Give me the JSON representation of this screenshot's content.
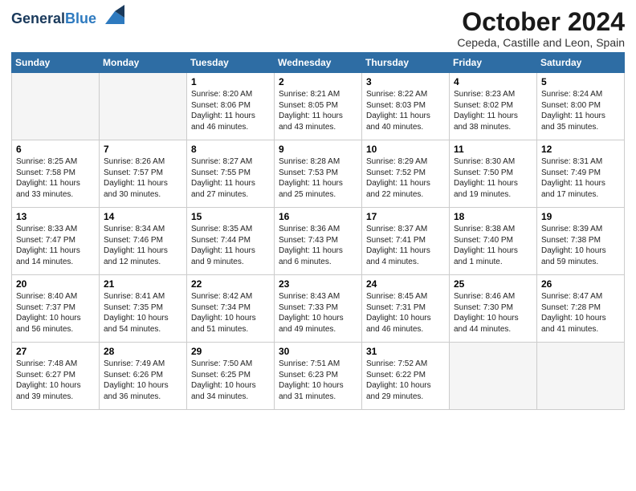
{
  "header": {
    "logo_line1": "General",
    "logo_line2": "Blue",
    "month_title": "October 2024",
    "subtitle": "Cepeda, Castille and Leon, Spain"
  },
  "weekdays": [
    "Sunday",
    "Monday",
    "Tuesday",
    "Wednesday",
    "Thursday",
    "Friday",
    "Saturday"
  ],
  "weeks": [
    [
      {
        "day": "",
        "empty": true
      },
      {
        "day": "",
        "empty": true
      },
      {
        "day": "1",
        "sunrise": "8:20 AM",
        "sunset": "8:06 PM",
        "daylight": "11 hours and 46 minutes."
      },
      {
        "day": "2",
        "sunrise": "8:21 AM",
        "sunset": "8:05 PM",
        "daylight": "11 hours and 43 minutes."
      },
      {
        "day": "3",
        "sunrise": "8:22 AM",
        "sunset": "8:03 PM",
        "daylight": "11 hours and 40 minutes."
      },
      {
        "day": "4",
        "sunrise": "8:23 AM",
        "sunset": "8:02 PM",
        "daylight": "11 hours and 38 minutes."
      },
      {
        "day": "5",
        "sunrise": "8:24 AM",
        "sunset": "8:00 PM",
        "daylight": "11 hours and 35 minutes."
      }
    ],
    [
      {
        "day": "6",
        "sunrise": "8:25 AM",
        "sunset": "7:58 PM",
        "daylight": "11 hours and 33 minutes."
      },
      {
        "day": "7",
        "sunrise": "8:26 AM",
        "sunset": "7:57 PM",
        "daylight": "11 hours and 30 minutes."
      },
      {
        "day": "8",
        "sunrise": "8:27 AM",
        "sunset": "7:55 PM",
        "daylight": "11 hours and 27 minutes."
      },
      {
        "day": "9",
        "sunrise": "8:28 AM",
        "sunset": "7:53 PM",
        "daylight": "11 hours and 25 minutes."
      },
      {
        "day": "10",
        "sunrise": "8:29 AM",
        "sunset": "7:52 PM",
        "daylight": "11 hours and 22 minutes."
      },
      {
        "day": "11",
        "sunrise": "8:30 AM",
        "sunset": "7:50 PM",
        "daylight": "11 hours and 19 minutes."
      },
      {
        "day": "12",
        "sunrise": "8:31 AM",
        "sunset": "7:49 PM",
        "daylight": "11 hours and 17 minutes."
      }
    ],
    [
      {
        "day": "13",
        "sunrise": "8:33 AM",
        "sunset": "7:47 PM",
        "daylight": "11 hours and 14 minutes."
      },
      {
        "day": "14",
        "sunrise": "8:34 AM",
        "sunset": "7:46 PM",
        "daylight": "11 hours and 12 minutes."
      },
      {
        "day": "15",
        "sunrise": "8:35 AM",
        "sunset": "7:44 PM",
        "daylight": "11 hours and 9 minutes."
      },
      {
        "day": "16",
        "sunrise": "8:36 AM",
        "sunset": "7:43 PM",
        "daylight": "11 hours and 6 minutes."
      },
      {
        "day": "17",
        "sunrise": "8:37 AM",
        "sunset": "7:41 PM",
        "daylight": "11 hours and 4 minutes."
      },
      {
        "day": "18",
        "sunrise": "8:38 AM",
        "sunset": "7:40 PM",
        "daylight": "11 hours and 1 minute."
      },
      {
        "day": "19",
        "sunrise": "8:39 AM",
        "sunset": "7:38 PM",
        "daylight": "10 hours and 59 minutes."
      }
    ],
    [
      {
        "day": "20",
        "sunrise": "8:40 AM",
        "sunset": "7:37 PM",
        "daylight": "10 hours and 56 minutes."
      },
      {
        "day": "21",
        "sunrise": "8:41 AM",
        "sunset": "7:35 PM",
        "daylight": "10 hours and 54 minutes."
      },
      {
        "day": "22",
        "sunrise": "8:42 AM",
        "sunset": "7:34 PM",
        "daylight": "10 hours and 51 minutes."
      },
      {
        "day": "23",
        "sunrise": "8:43 AM",
        "sunset": "7:33 PM",
        "daylight": "10 hours and 49 minutes."
      },
      {
        "day": "24",
        "sunrise": "8:45 AM",
        "sunset": "7:31 PM",
        "daylight": "10 hours and 46 minutes."
      },
      {
        "day": "25",
        "sunrise": "8:46 AM",
        "sunset": "7:30 PM",
        "daylight": "10 hours and 44 minutes."
      },
      {
        "day": "26",
        "sunrise": "8:47 AM",
        "sunset": "7:28 PM",
        "daylight": "10 hours and 41 minutes."
      }
    ],
    [
      {
        "day": "27",
        "sunrise": "7:48 AM",
        "sunset": "6:27 PM",
        "daylight": "10 hours and 39 minutes."
      },
      {
        "day": "28",
        "sunrise": "7:49 AM",
        "sunset": "6:26 PM",
        "daylight": "10 hours and 36 minutes."
      },
      {
        "day": "29",
        "sunrise": "7:50 AM",
        "sunset": "6:25 PM",
        "daylight": "10 hours and 34 minutes."
      },
      {
        "day": "30",
        "sunrise": "7:51 AM",
        "sunset": "6:23 PM",
        "daylight": "10 hours and 31 minutes."
      },
      {
        "day": "31",
        "sunrise": "7:52 AM",
        "sunset": "6:22 PM",
        "daylight": "10 hours and 29 minutes."
      },
      {
        "day": "",
        "empty": true
      },
      {
        "day": "",
        "empty": true
      }
    ]
  ],
  "labels": {
    "sunrise": "Sunrise:",
    "sunset": "Sunset:",
    "daylight": "Daylight:"
  }
}
